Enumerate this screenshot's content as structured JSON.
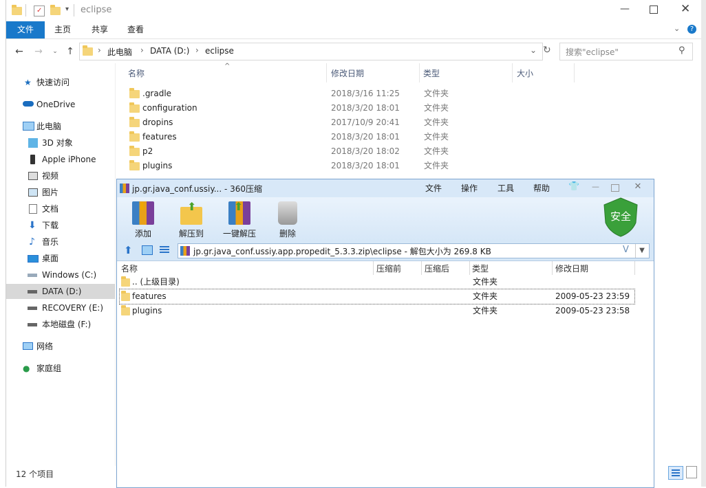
{
  "explorer": {
    "title": "eclipse",
    "ribbon_tabs": [
      {
        "label": "文件"
      },
      {
        "label": "主页"
      },
      {
        "label": "共享"
      },
      {
        "label": "查看"
      }
    ],
    "breadcrumb": [
      "此电脑",
      "DATA (D:)",
      "eclipse"
    ],
    "search_placeholder": "搜索\"eclipse\"",
    "columns": {
      "name": "名称",
      "modified": "修改日期",
      "type": "类型",
      "size": "大小"
    },
    "files": [
      {
        "name": ".gradle",
        "modified": "2018/3/16 11:25",
        "type": "文件夹"
      },
      {
        "name": "configuration",
        "modified": "2018/3/20 18:01",
        "type": "文件夹"
      },
      {
        "name": "dropins",
        "modified": "2017/10/9 20:41",
        "type": "文件夹"
      },
      {
        "name": "features",
        "modified": "2018/3/20 18:01",
        "type": "文件夹"
      },
      {
        "name": "p2",
        "modified": "2018/3/20 18:02",
        "type": "文件夹"
      },
      {
        "name": "plugins",
        "modified": "2018/3/20 18:01",
        "type": "文件夹"
      }
    ],
    "nav": [
      {
        "label": "快速访问",
        "icon": "star-icon"
      },
      {
        "label": "OneDrive",
        "icon": "cloud-icon"
      },
      {
        "label": "此电脑",
        "icon": "computer-icon"
      },
      {
        "label": "3D 对象",
        "icon": "cube-icon"
      },
      {
        "label": "Apple iPhone",
        "icon": "phone-icon"
      },
      {
        "label": "视频",
        "icon": "video-icon"
      },
      {
        "label": "图片",
        "icon": "picture-icon"
      },
      {
        "label": "文档",
        "icon": "document-icon"
      },
      {
        "label": "下载",
        "icon": "download-icon"
      },
      {
        "label": "音乐",
        "icon": "music-icon"
      },
      {
        "label": "桌面",
        "icon": "desktop-icon"
      },
      {
        "label": "Windows (C:)",
        "icon": "drive-icon"
      },
      {
        "label": "DATA (D:)",
        "icon": "drive-icon"
      },
      {
        "label": "RECOVERY (E:)",
        "icon": "drive-icon"
      },
      {
        "label": "本地磁盘 (F:)",
        "icon": "drive-icon"
      },
      {
        "label": "网络",
        "icon": "network-icon"
      },
      {
        "label": "家庭组",
        "icon": "homegroup-icon"
      }
    ],
    "status": "12 个项目"
  },
  "zip": {
    "title": "jp.gr.java_conf.ussiy... - 360压缩",
    "menu": [
      "文件",
      "操作",
      "工具",
      "帮助"
    ],
    "toolbar": [
      {
        "label": "添加"
      },
      {
        "label": "解压到"
      },
      {
        "label": "一键解压"
      },
      {
        "label": "删除"
      }
    ],
    "security_badge": "安全",
    "path": "jp.gr.java_conf.ussiy.app.propedit_5.3.3.zip\\eclipse - 解包大小为 269.8 KB",
    "columns": {
      "name": "名称",
      "before": "压缩前",
      "after": "压缩后",
      "type": "类型",
      "modified": "修改日期"
    },
    "rows": [
      {
        "name": ".. (上级目录)",
        "type": "文件夹",
        "modified": ""
      },
      {
        "name": "features",
        "type": "文件夹",
        "modified": "2009-05-23 23:59"
      },
      {
        "name": "plugins",
        "type": "文件夹",
        "modified": "2009-05-23 23:58"
      }
    ]
  },
  "colors": {
    "accent": "#1979ca",
    "zip_header": "#d8e8f8",
    "folder": "#f5d57a",
    "safe_green": "#3aa03a"
  }
}
